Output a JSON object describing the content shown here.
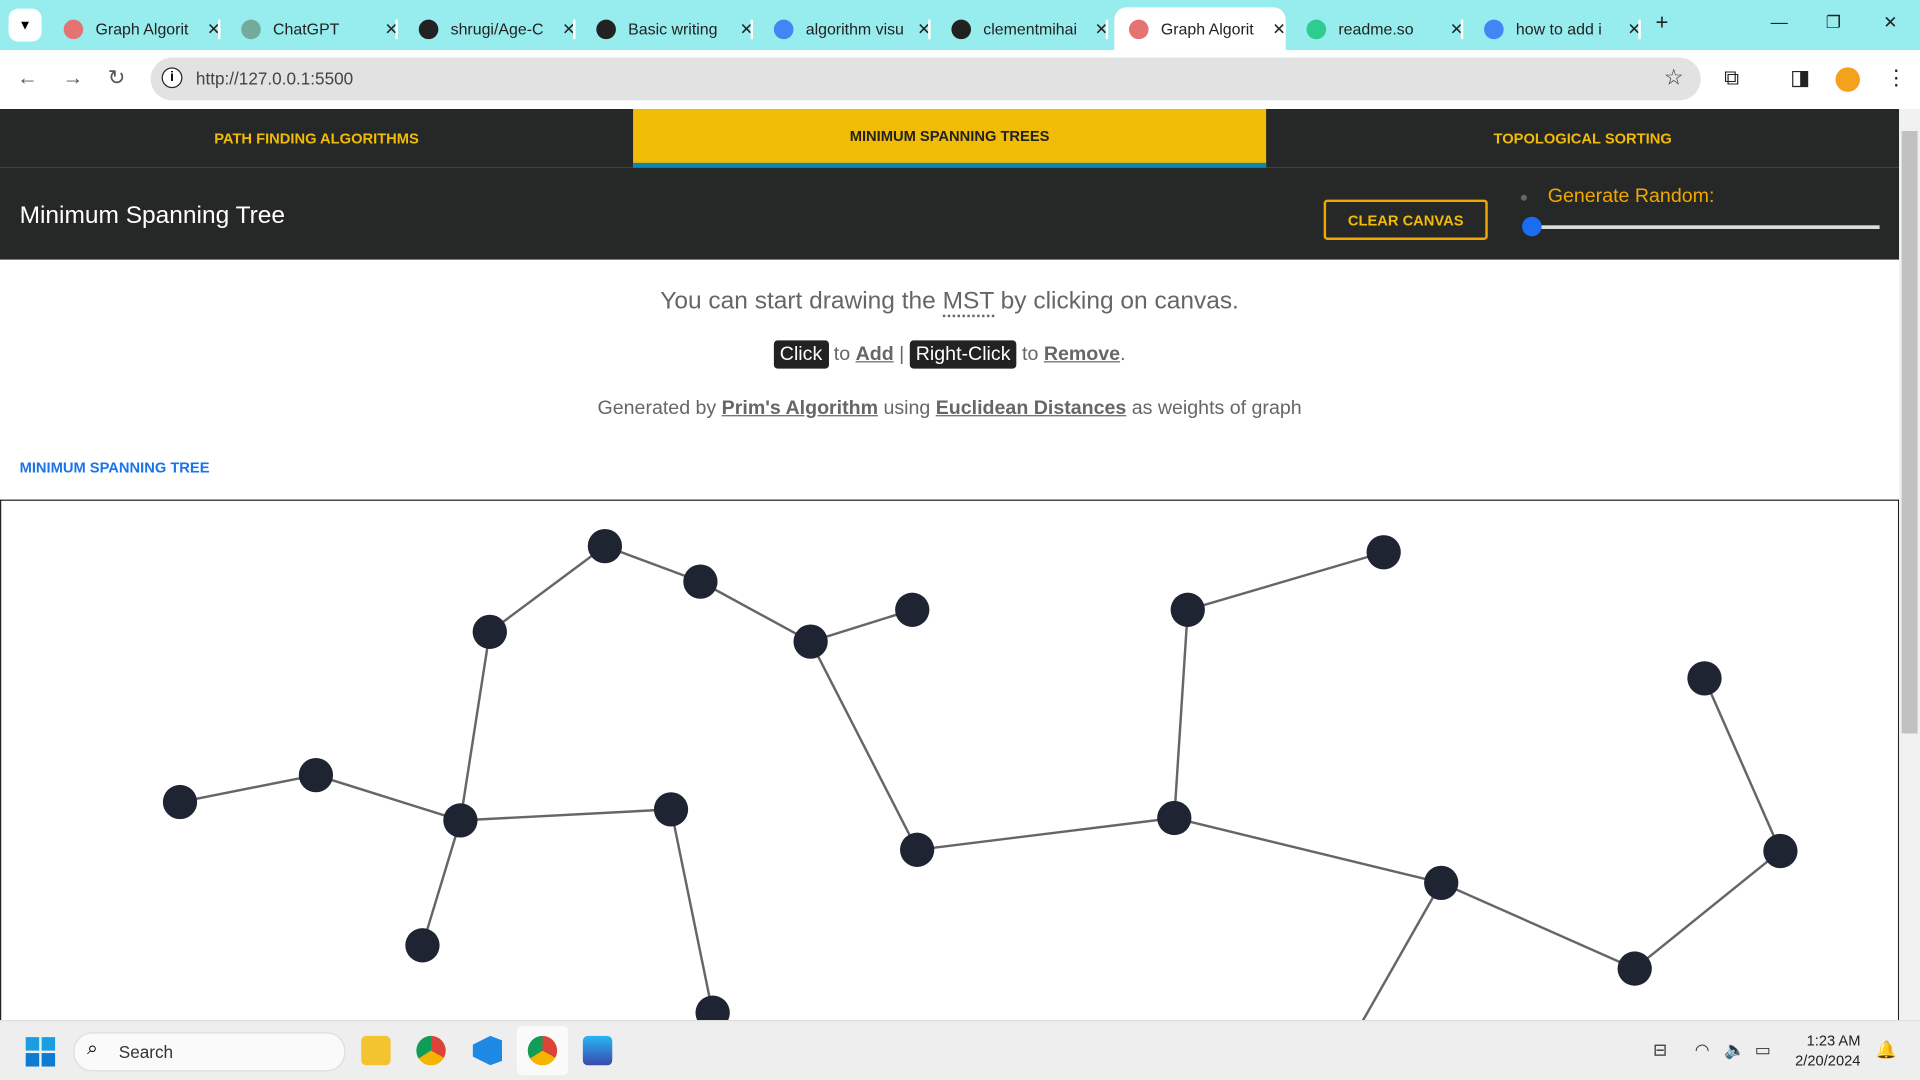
{
  "browser": {
    "tabs": [
      {
        "title": "Graph Algorit",
        "favicon": "#e57373"
      },
      {
        "title": "ChatGPT",
        "favicon": "#74aa9c"
      },
      {
        "title": "shrugi/Age-C",
        "favicon": "#222222"
      },
      {
        "title": "Basic writing",
        "favicon": "#222222"
      },
      {
        "title": "algorithm visu",
        "favicon": "#4285f4"
      },
      {
        "title": "clementmihai",
        "favicon": "#222222"
      },
      {
        "title": "Graph Algorit",
        "favicon": "#e57373",
        "active": true
      },
      {
        "title": "readme.so",
        "favicon": "#2ecc8f"
      },
      {
        "title": "how to add i",
        "favicon": "#4285f4"
      }
    ],
    "url": "http://127.0.0.1:5500"
  },
  "nav": {
    "items": [
      "PATH FINDING ALGORITHMS",
      "MINIMUM SPANNING TREES",
      "TOPOLOGICAL SORTING"
    ],
    "active_index": 1
  },
  "header": {
    "title": "Minimum Spanning Tree",
    "clear_button": "CLEAR CANVAS",
    "generate_label": "Generate Random:",
    "slider_value": 0
  },
  "intro": {
    "line1_pre": "You can start drawing the ",
    "line1_abbr": "MST",
    "line1_post": " by clicking on canvas.",
    "click": "Click",
    "to1": " to ",
    "add": "Add",
    "pipe": " | ",
    "right_click": "Right-Click",
    "to2": " to ",
    "remove": "Remove",
    "dot": ".",
    "gen_pre": "Generated by ",
    "prims": "Prim's Algorithm",
    "using": " using ",
    "euclid": "Euclidean Distances",
    "gen_post": " as weights of graph"
  },
  "section_label": "MINIMUM SPANNING TREE",
  "taskbar": {
    "search": "Search",
    "time": "1:23 AM",
    "date": "2/20/2024"
  },
  "colors": {
    "accent": "#f0bc05",
    "dark": "#262727",
    "node": "#1f2433",
    "edge": "#666666"
  }
}
